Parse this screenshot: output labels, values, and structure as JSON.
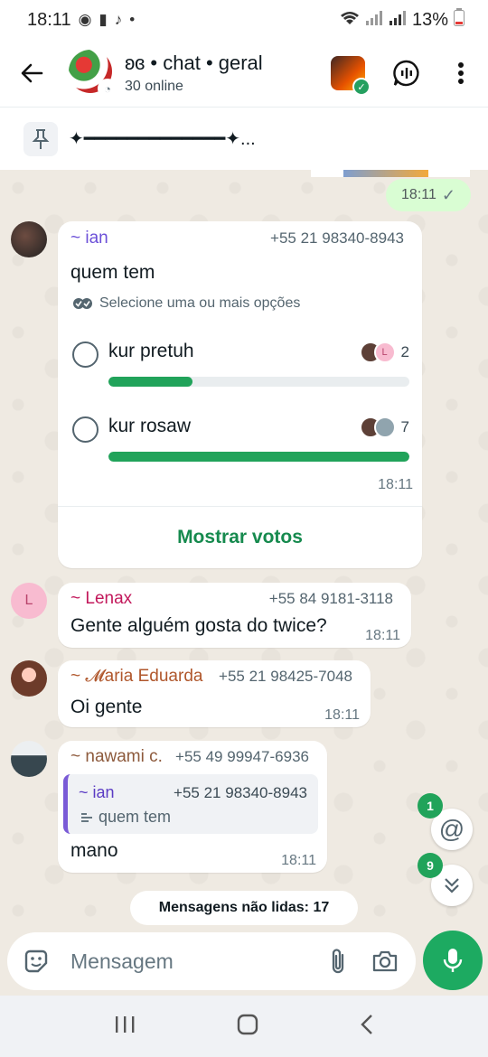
{
  "statusbar": {
    "time": "18:11",
    "battery": "13%"
  },
  "header": {
    "title": "ʚɞ • chat • geral",
    "subtitle": "30 online"
  },
  "pinned": {
    "text": "✦━━━━━━━━━━━━━✦..."
  },
  "outgoing": {
    "time": "18:11"
  },
  "poll": {
    "sender": "~ ian",
    "sender_color": "#6b4fd8",
    "phone": "+55 21 98340-8943",
    "question": "quem tem",
    "hint": "Selecione uma ou mais opções",
    "options": [
      {
        "label": "kur pretuh",
        "votes": "2",
        "fraction": 0.28
      },
      {
        "label": "kur rosaw",
        "votes": "7",
        "fraction": 1.0
      }
    ],
    "time": "18:11",
    "show_votes": "Mostrar votos"
  },
  "messages": [
    {
      "sender": "~ Lenax",
      "phone": "+55 84 9181-3118",
      "text": "Gente alguém gosta do twice?",
      "time": "18:11",
      "avatar_letter": "L"
    },
    {
      "sender": "~ 𝓜aria Eduarda",
      "phone": "+55 21 98425-7048",
      "text": "Oi gente",
      "time": "18:11"
    },
    {
      "sender": "~ nawami c.",
      "phone": "+55 49 99947-6936",
      "quote_sender": "~ ian",
      "quote_phone": "+55 21 98340-8943",
      "quote_text": "quem tem",
      "text": "mano",
      "time": "18:11"
    }
  ],
  "unread": "Mensagens não lidas: 17",
  "mention_badge": "1",
  "scroll_badge": "9",
  "composer": {
    "placeholder": "Mensagem"
  },
  "colors": {
    "accent": "#1daa61",
    "lenax": "#c2185b",
    "maria": "#b0572c",
    "nawami": "#8d5a3c"
  }
}
